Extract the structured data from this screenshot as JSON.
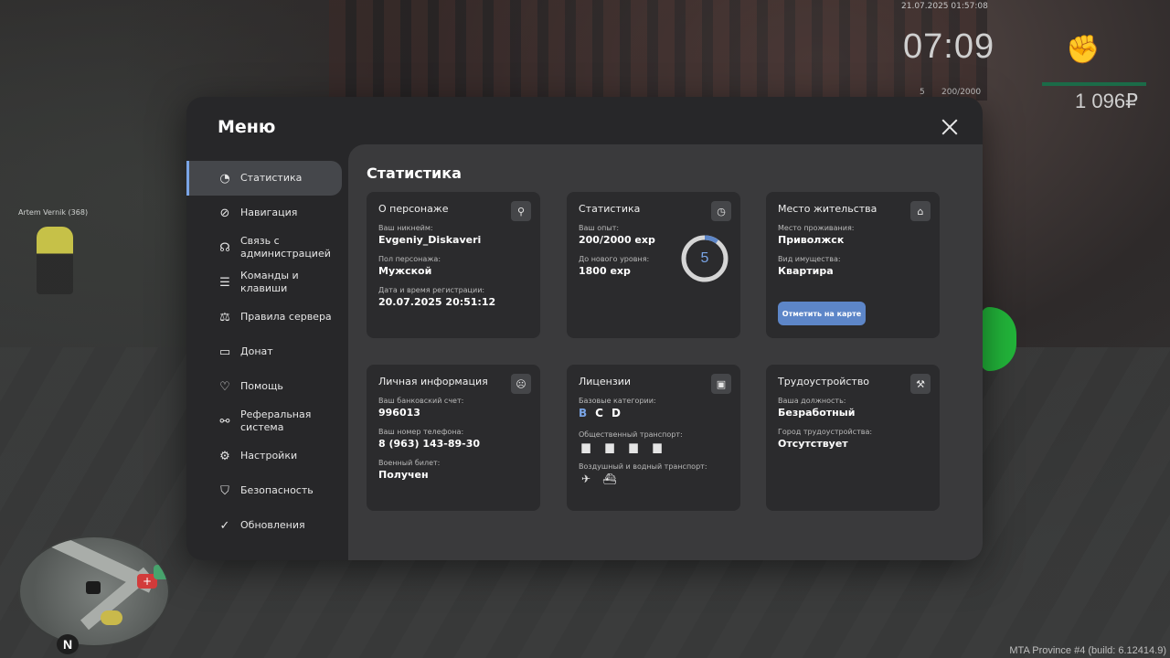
{
  "world": {
    "player_tag": "Artem Vernik (368)"
  },
  "hud": {
    "date": "21.07.2025 01:57:08",
    "clock": "07:09",
    "level": "5",
    "exp": "200/2000",
    "money": "1 096₽",
    "build": "MTA Province #4 (build: 6.12414.9)"
  },
  "menu": {
    "title": "Меню",
    "content_title": "Статистика",
    "sidebar": [
      {
        "label": "Статистика",
        "icon": "pie-icon",
        "glyph": "◔"
      },
      {
        "label": "Навигация",
        "icon": "compass-icon",
        "glyph": "⊘"
      },
      {
        "label": "Связь с администрацией",
        "icon": "headset-icon",
        "glyph": "☊"
      },
      {
        "label": "Команды и клавиши",
        "icon": "document-icon",
        "glyph": "☰"
      },
      {
        "label": "Правила сервера",
        "icon": "scales-icon",
        "glyph": "⚖"
      },
      {
        "label": "Донат",
        "icon": "wallet-icon",
        "glyph": "▭"
      },
      {
        "label": "Помощь",
        "icon": "heart-hand-icon",
        "glyph": "♡"
      },
      {
        "label": "Реферальная система",
        "icon": "network-icon",
        "glyph": "⚯"
      },
      {
        "label": "Настройки",
        "icon": "gear-icon",
        "glyph": "⚙"
      },
      {
        "label": "Безопасность",
        "icon": "shield-icon",
        "glyph": "⛉"
      },
      {
        "label": "Обновления",
        "icon": "refresh-check-icon",
        "glyph": "✓"
      }
    ]
  },
  "cards": {
    "character": {
      "title": "О персонаже",
      "nickname_label": "Ваш никнейм:",
      "nickname": "Evgeniy_Diskaveri",
      "gender_label": "Пол персонажа:",
      "gender": "Мужской",
      "reg_label": "Дата и время регистрации:",
      "reg": "20.07.2025 20:51:12"
    },
    "stats": {
      "title": "Статистика",
      "exp_label": "Ваш опыт:",
      "exp": "200/2000 exp",
      "next_label": "До нового уровня:",
      "next": "1800 exp",
      "level": "5",
      "progress": 0.1
    },
    "residence": {
      "title": "Место жительства",
      "place_label": "Место проживания:",
      "place": "Приволжск",
      "property_label": "Вид имущества:",
      "property": "Квартира",
      "map_button": "Отметить на карте"
    },
    "personal": {
      "title": "Личная информация",
      "bank_label": "Ваш банковский счет:",
      "bank": "996013",
      "phone_label": "Ваш номер телефона:",
      "phone": "8 (963) 143-89-30",
      "military_label": "Военный билет:",
      "military": "Получен"
    },
    "licenses": {
      "title": "Лицензии",
      "base_label": "Базовые категории:",
      "categories": [
        "B",
        "C",
        "D"
      ],
      "public_label": "Общественный транспорт:",
      "air_label": "Воздушный и водный транспорт:"
    },
    "employment": {
      "title": "Трудоустройство",
      "position_label": "Ваша должность:",
      "position": "Безработный",
      "city_label": "Город трудоустройства:",
      "city": "Отсутствует"
    }
  },
  "colors": {
    "accent": "#7aa5e6",
    "button": "#5d86c8"
  }
}
